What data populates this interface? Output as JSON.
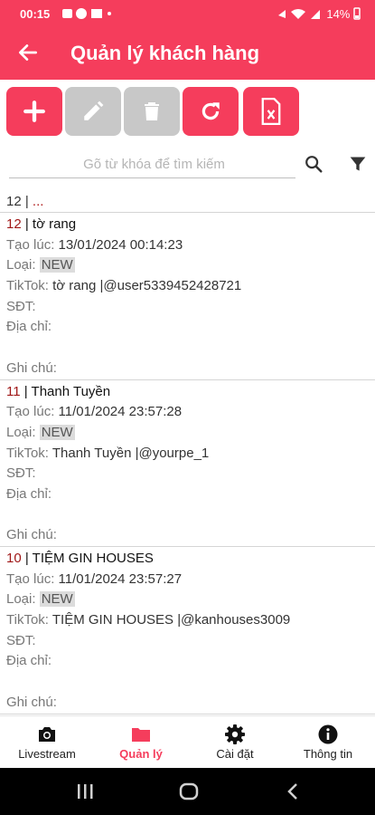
{
  "status_bar": {
    "time": "00:15",
    "battery": "14%"
  },
  "appbar": {
    "title": "Quản lý khách hàng"
  },
  "search": {
    "placeholder": "Gõ từ khóa để tìm kiếm"
  },
  "list": {
    "header_id": "12",
    "header_sep": " | ",
    "header_ellipsis": "...",
    "records": [
      {
        "id": "12",
        "name": "tờ rang",
        "created_label": "Tạo lúc:",
        "created": "13/01/2024 00:14:23",
        "type_label": "Loại:",
        "type": "NEW",
        "tiktok_label": "TikTok:",
        "tiktok": "tờ rang |@user5339452428721",
        "phone_label": "SĐT:",
        "address_label": "Địa chỉ:",
        "note_label": "Ghi chú:"
      },
      {
        "id": "11",
        "name": "Thanh Tuyền",
        "created_label": "Tạo lúc:",
        "created": "11/01/2024 23:57:28",
        "type_label": "Loại:",
        "type": "NEW",
        "tiktok_label": "TikTok:",
        "tiktok": "Thanh Tuyền |@yourpe_1",
        "phone_label": "SĐT:",
        "address_label": "Địa chỉ:",
        "note_label": "Ghi chú:"
      },
      {
        "id": "10",
        "name": "TIỆM GIN HOUSES",
        "created_label": "Tạo lúc:",
        "created": "11/01/2024 23:57:27",
        "type_label": "Loại:",
        "type": "NEW",
        "tiktok_label": "TikTok:",
        "tiktok": "TIỆM GIN HOUSES |@kanhouses3009",
        "phone_label": "SĐT:",
        "address_label": "Địa chỉ:",
        "note_label": "Ghi chú:"
      }
    ]
  },
  "bottom_nav": [
    {
      "label": "Livestream",
      "icon": "camera-icon"
    },
    {
      "label": "Quản lý",
      "icon": "folder-icon"
    },
    {
      "label": "Cài đặt",
      "icon": "gear-icon"
    },
    {
      "label": "Thông tin",
      "icon": "info-icon"
    }
  ],
  "colors": {
    "accent": "#f53d5c",
    "disabled": "#c8c8c8",
    "id_color": "#a01818"
  }
}
